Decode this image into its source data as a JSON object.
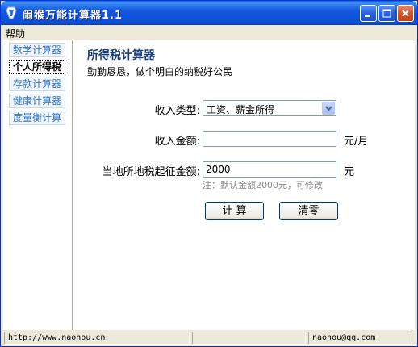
{
  "window": {
    "title": "闹猴万能计算器1.1"
  },
  "menu": {
    "help": "帮助"
  },
  "sidebar": {
    "items": [
      {
        "label": "数学计算器"
      },
      {
        "label": "个人所得税"
      },
      {
        "label": "存款计算器"
      },
      {
        "label": "健康计算器"
      },
      {
        "label": "度量衡计算"
      }
    ],
    "active_index": 1
  },
  "panel": {
    "title": "所得税计算器",
    "subtitle": "勤勤恳恳，做个明白的纳税好公民"
  },
  "form": {
    "income_type_label": "收入类型:",
    "income_type_value": "工资、薪金所得",
    "income_amount_label": "收入金额:",
    "income_amount_value": "",
    "income_amount_unit": "元/月",
    "threshold_label": "当地所地税起征金额:",
    "threshold_value": "2000",
    "threshold_unit": "元",
    "threshold_hint": "注：默认金额2000元，可修改"
  },
  "buttons": {
    "calculate": "计 算",
    "clear": "清零"
  },
  "status": {
    "left": "http://www.naohou.cn",
    "right": "naohou@qq.com"
  },
  "colors": {
    "titlebar": "#0b4fd6",
    "sidebar_text": "#2e74c9",
    "panel_title": "#1a3f7a"
  }
}
